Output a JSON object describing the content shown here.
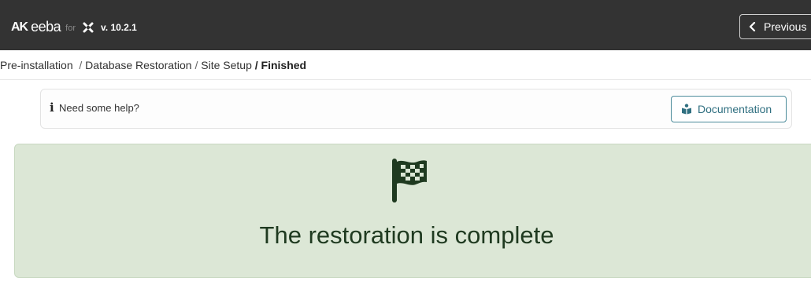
{
  "header": {
    "logo_prefix": "AK",
    "logo_name": "eeba",
    "logo_for": "for",
    "version": "v. 10.2.1",
    "previous_label": "Previous"
  },
  "breadcrumb": {
    "items": [
      "Pre-installation",
      "Database Restoration",
      "Site Setup"
    ],
    "separator": "/",
    "current": "Finished"
  },
  "help": {
    "text": "Need some help?",
    "documentation_label": "Documentation"
  },
  "status": {
    "title": "The restoration is complete"
  },
  "colors": {
    "topbar": "#333333",
    "success_bg": "#dce7d6",
    "success_text": "#1f3a20",
    "doc_button": "#2f6f80"
  },
  "icons": [
    "joomla-icon",
    "chevron-left-icon",
    "info-icon",
    "book-reader-icon",
    "checkered-flag-icon"
  ]
}
